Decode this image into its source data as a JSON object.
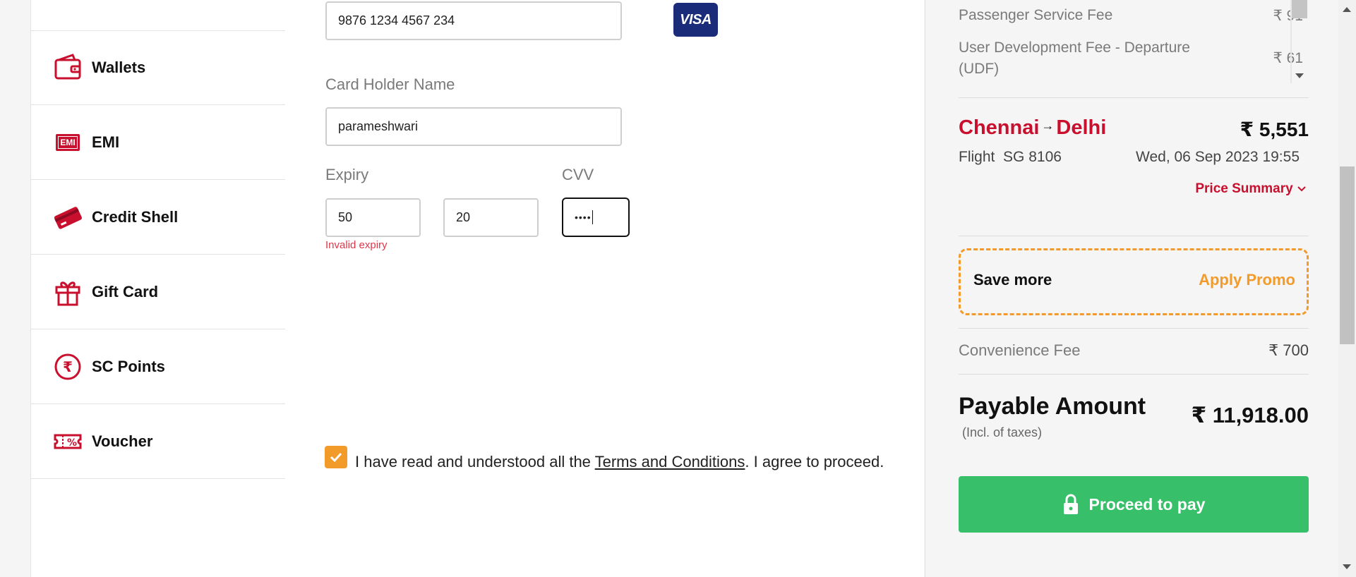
{
  "sidebar": {
    "items": [
      {
        "label": "Wallets",
        "icon": "wallet-icon"
      },
      {
        "label": "EMI",
        "icon": "emi-icon",
        "badge": "EMI"
      },
      {
        "label": "Credit Shell",
        "icon": "credit-card-icon"
      },
      {
        "label": "Gift Card",
        "icon": "gift-icon"
      },
      {
        "label": "SC Points",
        "icon": "rupee-coin-icon"
      },
      {
        "label": "Voucher",
        "icon": "voucher-icon"
      }
    ]
  },
  "card_form": {
    "card_number_value": "9876 1234 4567 234",
    "card_brand": "VISA",
    "holder_label": "Card Holder Name",
    "holder_value": "parameshwari",
    "expiry_label": "Expiry",
    "expiry_month": "50",
    "expiry_year": "20",
    "cvv_label": "CVV",
    "cvv_value": "••••",
    "expiry_error": "Invalid expiry"
  },
  "terms": {
    "checked": true,
    "text_before": "I have read and understood all the ",
    "link_text": "Terms and Conditions",
    "text_after": ". I agree to proceed."
  },
  "fare_details": {
    "fees": [
      {
        "label": "Passenger Service Fee",
        "amount": "₹ 91"
      },
      {
        "label": "User Development Fee - Departure (UDF)",
        "amount": "₹ 61"
      }
    ]
  },
  "trip": {
    "origin": "Chennai",
    "arrow": "→",
    "destination": "Delhi",
    "price": "₹ 5,551",
    "flight_label": "Flight",
    "flight_number": "SG 8106",
    "datetime": "Wed, 06 Sep 2023 19:55",
    "price_summary_label": "Price Summary"
  },
  "promo": {
    "text": "Save more",
    "action": "Apply Promo"
  },
  "convenience": {
    "label": "Convenience Fee",
    "amount": "₹ 700"
  },
  "payable": {
    "label": "Payable Amount",
    "sub_label": "(Incl. of taxes)",
    "amount": "₹ 11,918.00"
  },
  "pay_button": {
    "label": "Proceed to pay"
  },
  "colors": {
    "brand_red": "#c8102e",
    "accent_orange": "#f39b2a",
    "pay_green": "#38bf6a",
    "visa_blue": "#1a2b7a"
  }
}
